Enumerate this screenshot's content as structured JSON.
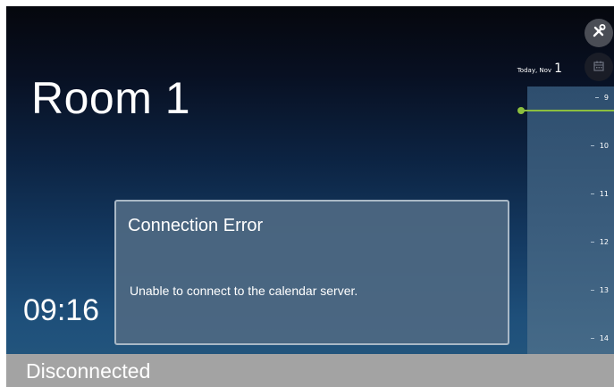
{
  "room": {
    "name": "Room 1"
  },
  "clock": {
    "time": "09:16"
  },
  "calendar": {
    "date_label": "Today, Nov",
    "day": "1",
    "hours": [
      "9",
      "10",
      "11",
      "12",
      "13",
      "14"
    ],
    "now_indicator_color": "#8cbf3f"
  },
  "toolbar": {
    "settings_icon": "tools-icon",
    "calendar_icon": "calendar-icon"
  },
  "dialog": {
    "title": "Connection Error",
    "message": "Unable to connect to the calendar server."
  },
  "status": {
    "text": "Disconnected",
    "bar_color": "#a3a3a3"
  }
}
